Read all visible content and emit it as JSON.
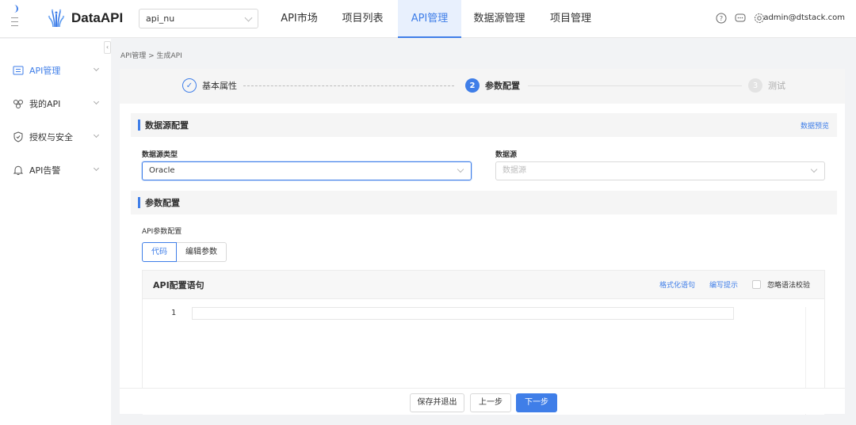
{
  "app": {
    "name": "DataAPI"
  },
  "header": {
    "project_value": "api_nu",
    "nav": [
      {
        "label": "API市场",
        "active": false
      },
      {
        "label": "项目列表",
        "active": false
      },
      {
        "label": "API管理",
        "active": true
      },
      {
        "label": "数据源管理",
        "active": false
      },
      {
        "label": "项目管理",
        "active": false
      }
    ],
    "icons": [
      "help-icon",
      "message-icon",
      "settings-icon"
    ],
    "user": "admin@dtstack.com"
  },
  "sidebar": {
    "items": [
      {
        "label": "API管理",
        "icon": "api-list-icon",
        "active": true
      },
      {
        "label": "我的API",
        "icon": "my-api-icon",
        "active": false
      },
      {
        "label": "授权与安全",
        "icon": "shield-icon",
        "active": false
      },
      {
        "label": "API告警",
        "icon": "bell-icon",
        "active": false
      }
    ],
    "collapse_glyph": "‹"
  },
  "breadcrumb": "API管理 > 生成API",
  "steps": [
    {
      "index": "✓",
      "label": "基本属性",
      "state": "done"
    },
    {
      "index": "2",
      "label": "参数配置",
      "state": "current"
    },
    {
      "index": "3",
      "label": "测试",
      "state": "todo"
    }
  ],
  "datasource_section": {
    "title": "数据源配置",
    "preview_link": "数据预览",
    "type_label": "数据源类型",
    "type_value": "Oracle",
    "source_label": "数据源",
    "source_placeholder": "数据源"
  },
  "param_section": {
    "title": "参数配置",
    "api_param_label": "API参数配置",
    "tabs": [
      {
        "label": "代码",
        "active": true
      },
      {
        "label": "编辑参数",
        "active": false
      }
    ]
  },
  "editor": {
    "title": "API配置语句",
    "format_link": "格式化语句",
    "hint_link": "编写提示",
    "ignore_check_label": "忽略语法校验",
    "ignore_checked": false,
    "line_number": "1"
  },
  "footer": {
    "save_exit": "保存并退出",
    "prev": "上一步",
    "next": "下一步"
  },
  "colors": {
    "primary": "#3f7ee8",
    "background": "#f2f3f5"
  }
}
